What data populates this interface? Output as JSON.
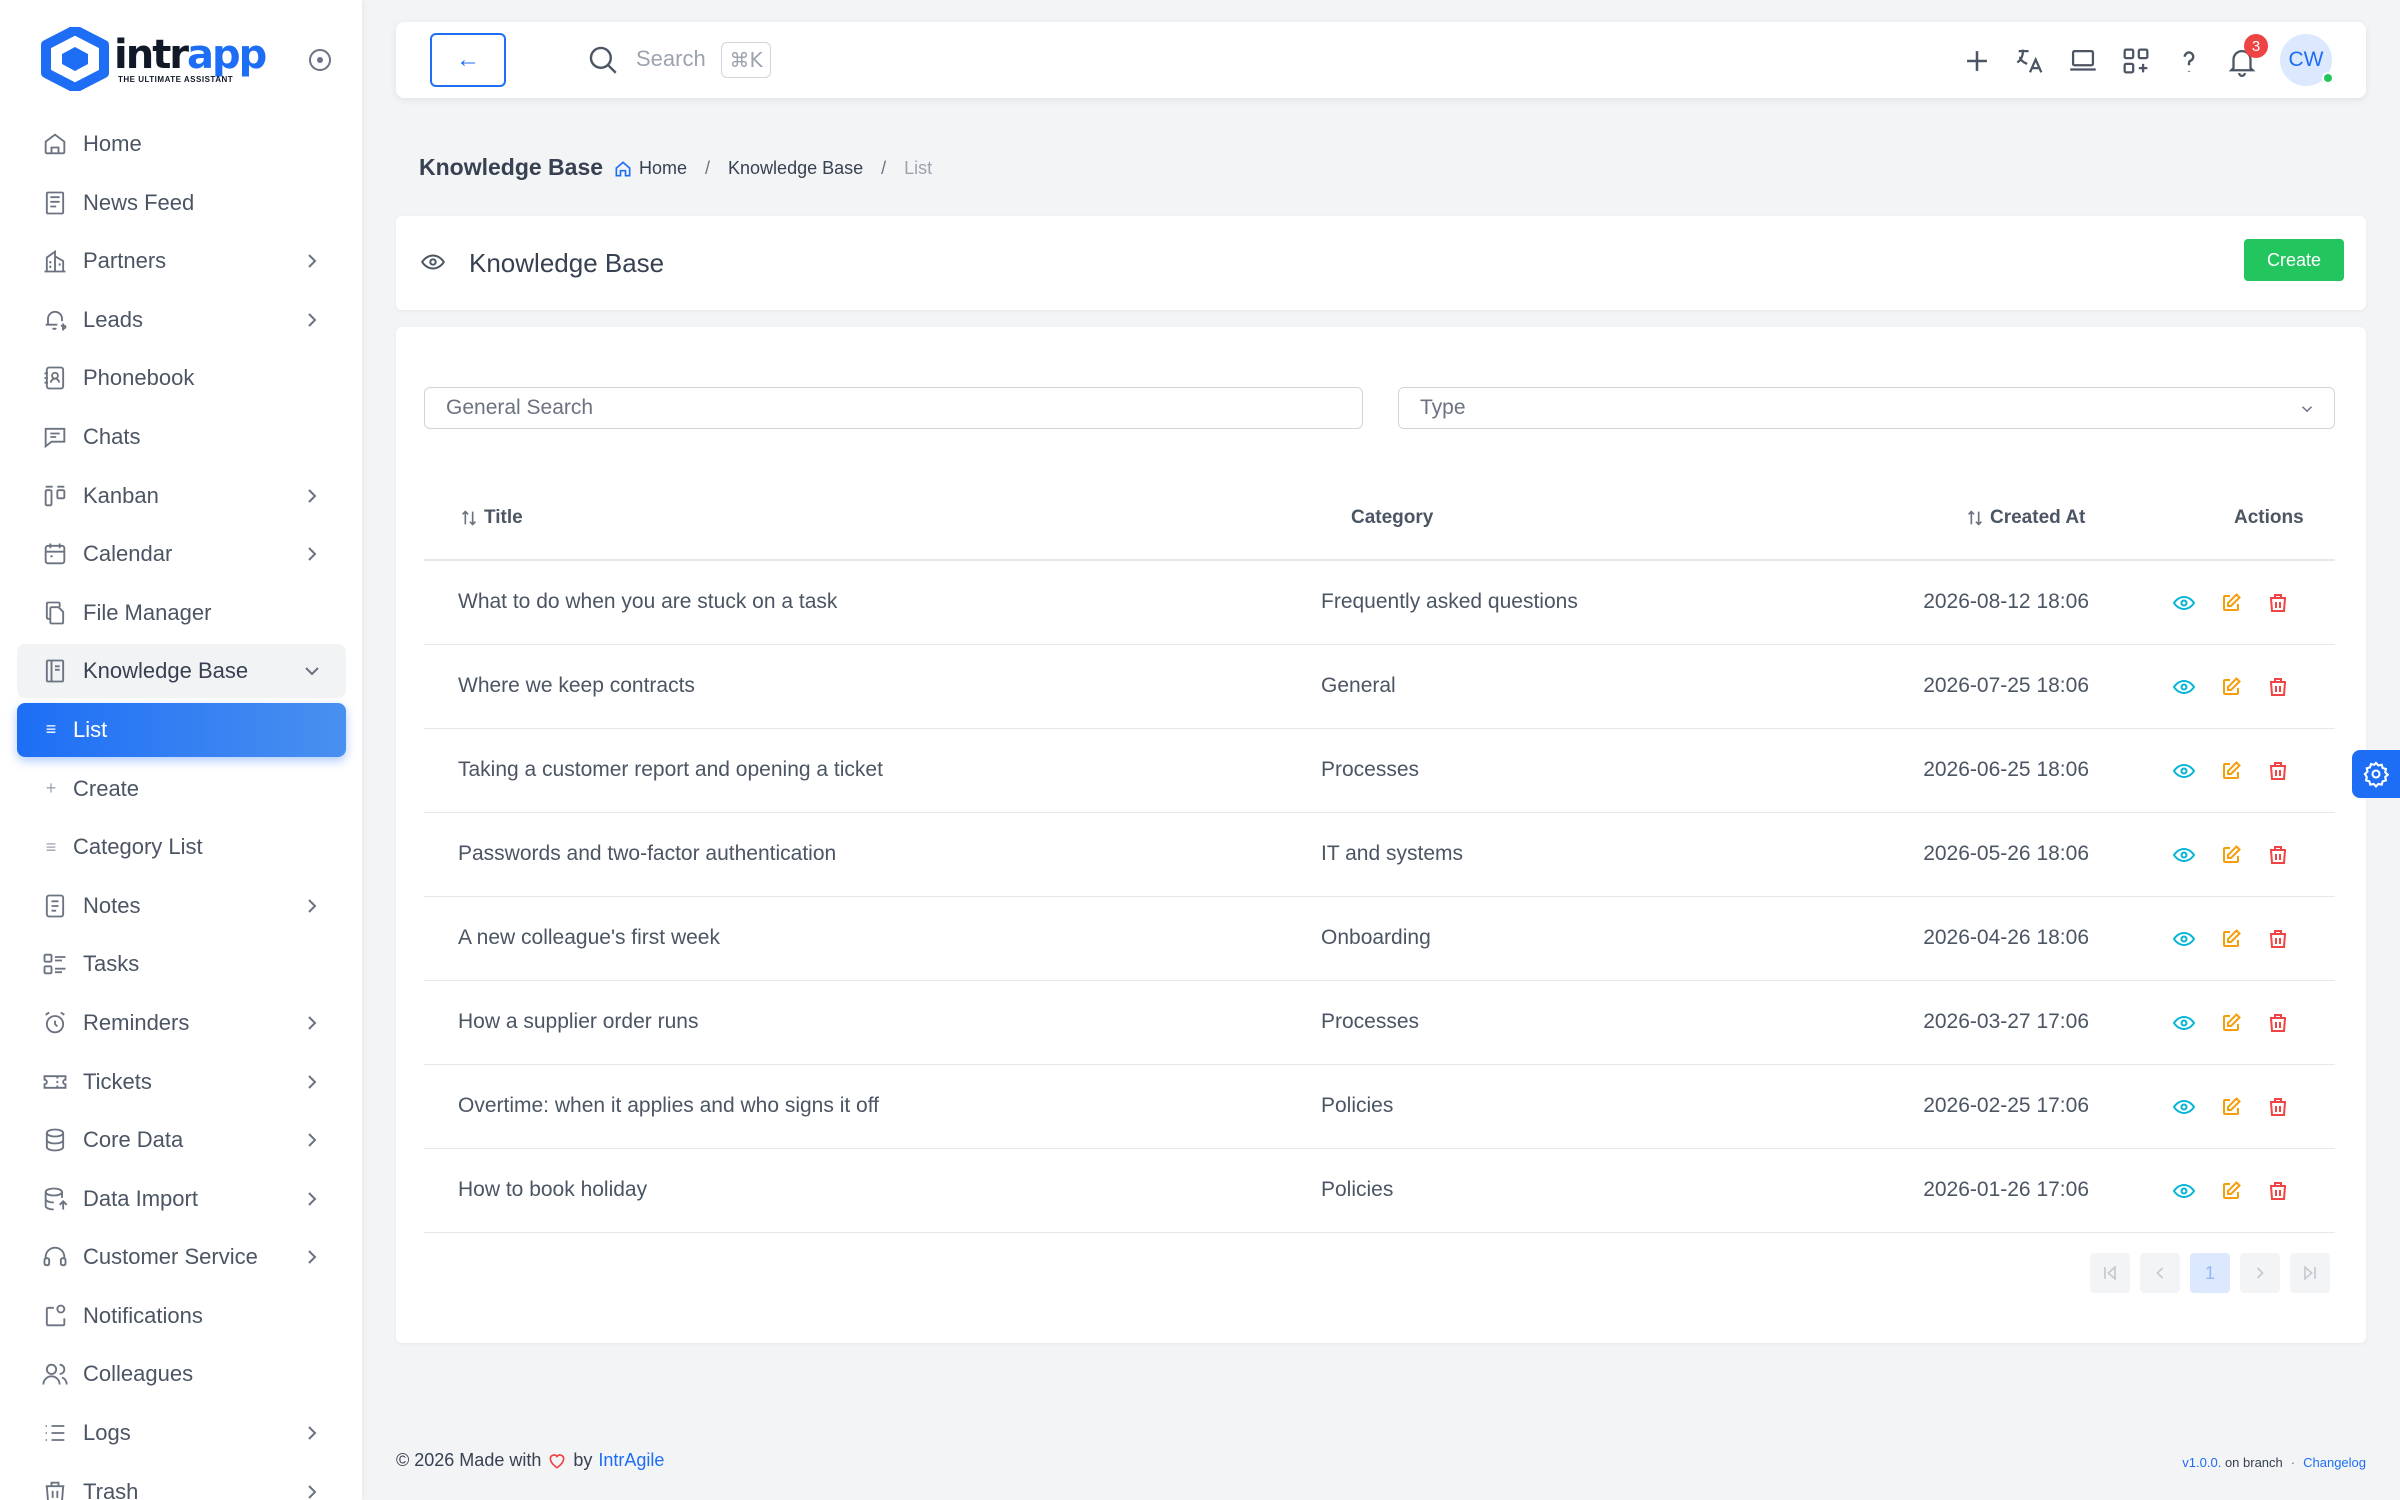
{
  "app": {
    "logo_text_a": "intr",
    "logo_text_b": "app",
    "logo_tagline": "THE ULTIMATE ASSISTANT",
    "brand_color": "#1d6ef5"
  },
  "sidebar": {
    "items": [
      {
        "label": "Home",
        "icon": "home-icon",
        "chevron": false
      },
      {
        "label": "News Feed",
        "icon": "newspaper-icon",
        "chevron": false
      },
      {
        "label": "Partners",
        "icon": "building-icon",
        "chevron": true
      },
      {
        "label": "Leads",
        "icon": "bell-dollar-icon",
        "chevron": true
      },
      {
        "label": "Phonebook",
        "icon": "address-book-icon",
        "chevron": false
      },
      {
        "label": "Chats",
        "icon": "chat-icon",
        "chevron": false
      },
      {
        "label": "Kanban",
        "icon": "kanban-icon",
        "chevron": true
      },
      {
        "label": "Calendar",
        "icon": "calendar-icon",
        "chevron": true
      },
      {
        "label": "File Manager",
        "icon": "files-icon",
        "chevron": false
      },
      {
        "label": "Knowledge Base",
        "icon": "book-icon",
        "chevron": true,
        "open": true
      },
      {
        "label": "Notes",
        "icon": "note-icon",
        "chevron": true
      },
      {
        "label": "Tasks",
        "icon": "tasks-icon",
        "chevron": false
      },
      {
        "label": "Reminders",
        "icon": "alarm-icon",
        "chevron": true
      },
      {
        "label": "Tickets",
        "icon": "ticket-icon",
        "chevron": true
      },
      {
        "label": "Core Data",
        "icon": "database-icon",
        "chevron": true
      },
      {
        "label": "Data Import",
        "icon": "database-import-icon",
        "chevron": true
      },
      {
        "label": "Customer Service",
        "icon": "headset-icon",
        "chevron": true
      },
      {
        "label": "Notifications",
        "icon": "notification-icon",
        "chevron": false
      },
      {
        "label": "Colleagues",
        "icon": "users-icon",
        "chevron": false
      },
      {
        "label": "Logs",
        "icon": "list-icon",
        "chevron": true
      },
      {
        "label": "Trash",
        "icon": "trash-icon",
        "chevron": true
      }
    ],
    "sub_items": [
      {
        "label": "List",
        "glyph": "≡",
        "active": true
      },
      {
        "label": "Create",
        "glyph": "+"
      },
      {
        "label": "Category List",
        "glyph": "≡"
      }
    ]
  },
  "topbar": {
    "back_label": "←",
    "search_placeholder": "Search",
    "search_shortcut": "⌘K",
    "notification_count": "3",
    "avatar_initials": "CW"
  },
  "breadcrumb": {
    "page_title": "Knowledge Base",
    "home": "Home",
    "section": "Knowledge Base",
    "current": "List",
    "separator": "/"
  },
  "header": {
    "title": "Knowledge Base",
    "create_label": "Create",
    "create_color": "#22c55e"
  },
  "filters": {
    "search_placeholder": "General Search",
    "type_placeholder": "Type"
  },
  "table": {
    "columns": {
      "title": "Title",
      "category": "Category",
      "created_at": "Created At",
      "actions": "Actions"
    },
    "rows": [
      {
        "title": "What to do when you are stuck on a task",
        "category": "Frequently asked questions",
        "created_at": "2026-08-12 18:06"
      },
      {
        "title": "Where we keep contracts",
        "category": "General",
        "created_at": "2026-07-25 18:06"
      },
      {
        "title": "Taking a customer report and opening a ticket",
        "category": "Processes",
        "created_at": "2026-06-25 18:06"
      },
      {
        "title": "Passwords and two-factor authentication",
        "category": "IT and systems",
        "created_at": "2026-05-26 18:06"
      },
      {
        "title": "A new colleague's first week",
        "category": "Onboarding",
        "created_at": "2026-04-26 18:06"
      },
      {
        "title": "How a supplier order runs",
        "category": "Processes",
        "created_at": "2026-03-27 17:06"
      },
      {
        "title": "Overtime: when it applies and who signs it off",
        "category": "Policies",
        "created_at": "2026-02-25 17:06"
      },
      {
        "title": "How to book holiday",
        "category": "Policies",
        "created_at": "2026-01-26 17:06"
      }
    ],
    "action_colors": {
      "view": "#06b6d4",
      "edit": "#f59e0b",
      "delete": "#ef4444"
    }
  },
  "pagination": {
    "current_page": "1"
  },
  "footer": {
    "copyright": "© 2026 Made with",
    "by": "by",
    "brand": "IntrAgile",
    "version": "v1.0.0.",
    "branch": "on branch",
    "dot": "·",
    "changelog": "Changelog"
  }
}
